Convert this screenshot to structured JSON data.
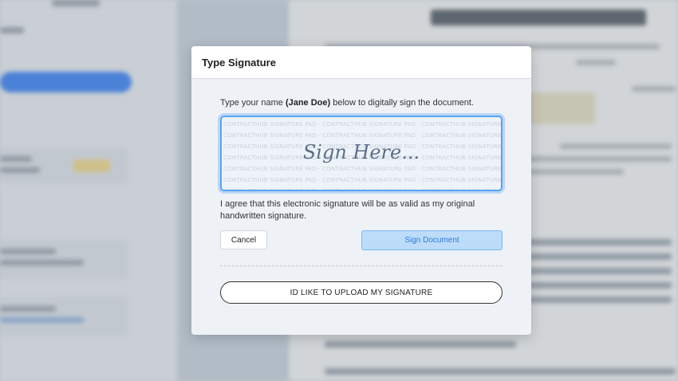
{
  "modal": {
    "title": "Type Signature",
    "instruction_prefix": "Type your name ",
    "signer_name": "(Jane Doe)",
    "instruction_suffix": " below to digitally sign the document.",
    "signature_placeholder": "Sign Here...",
    "watermark_text": "CONTRACTHUB SIGNATURE PAD",
    "agreement_text": "I agree that this electronic signature will be as valid as my original handwritten signature.",
    "cancel_label": "Cancel",
    "sign_label": "Sign Document",
    "upload_label": "ID LIKE TO UPLOAD MY SIGNATURE"
  },
  "colors": {
    "accent": "#5ba3f5",
    "sign_button_bg": "#bcdcfa",
    "sign_button_text": "#2f7ad6",
    "modal_bg": "#eef2f7"
  }
}
